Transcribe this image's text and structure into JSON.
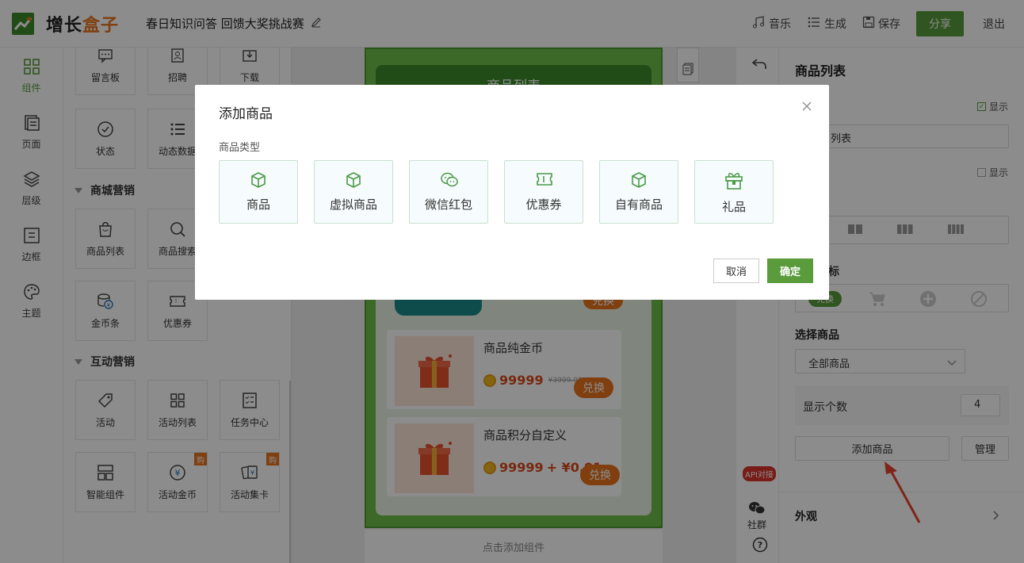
{
  "header": {
    "logo_part1": "增长",
    "logo_part2": "盒子",
    "doc_title": "春日知识问答 回馈大奖挑战赛",
    "music": "音乐",
    "generate": "生成",
    "save": "保存",
    "share": "分享",
    "exit": "退出"
  },
  "rail": [
    {
      "label": "组件",
      "icon": "grid-icon"
    },
    {
      "label": "页面",
      "icon": "pages-icon"
    },
    {
      "label": "层级",
      "icon": "layers-icon"
    },
    {
      "label": "边框",
      "icon": "border-icon"
    },
    {
      "label": "主题",
      "icon": "palette-icon"
    }
  ],
  "panel": {
    "top_tiles": [
      "留言板",
      "招聘",
      "下载",
      "状态",
      "动态数据"
    ],
    "section_mall": "商城营销",
    "mall_tiles": [
      "商品列表",
      "商品搜索",
      "金币条",
      "优惠券"
    ],
    "section_interact": "互动营销",
    "interact_tiles": [
      "活动",
      "活动列表",
      "任务中心",
      "智能组件",
      "活动金币",
      "活动集卡"
    ],
    "buy_badge": "购"
  },
  "canvas": {
    "banner": "商品列表",
    "exchange": "兑换",
    "products": [
      {
        "name": "商品纯金币",
        "price": "99999",
        "old": "¥3999.00"
      },
      {
        "name": "商品积分自定义",
        "price": "99999",
        "extra": "+ ¥0.01"
      }
    ],
    "add_component": "点击添加组件"
  },
  "tools": {
    "api": "API对接",
    "community": "社群"
  },
  "right": {
    "title": "商品列表",
    "show": "显示",
    "title_value": "列表",
    "show2": "显示",
    "icon_section_tail": "标",
    "icon_chip": "兑换",
    "select_goods_label": "选择商品",
    "select_goods_value": "全部商品",
    "count_label": "显示个数",
    "count_value": "4",
    "add_goods": "添加商品",
    "manage": "管理",
    "appearance": "外观"
  },
  "modal": {
    "title": "添加商品",
    "subtitle": "商品类型",
    "options": [
      {
        "label": "商品",
        "icon": "box-icon"
      },
      {
        "label": "虚拟商品",
        "icon": "virtual-box-icon"
      },
      {
        "label": "微信红包",
        "icon": "wechat-icon"
      },
      {
        "label": "优惠券",
        "icon": "coupon-icon"
      },
      {
        "label": "自有商品",
        "icon": "own-box-icon"
      },
      {
        "label": "礼品",
        "icon": "gift-icon"
      }
    ],
    "cancel": "取消",
    "ok": "确定"
  },
  "colors": {
    "brand_green": "#5a9b3c",
    "accent_orange": "#e8731d",
    "price_red": "#d9491c",
    "arrow_red": "#e8432f"
  }
}
